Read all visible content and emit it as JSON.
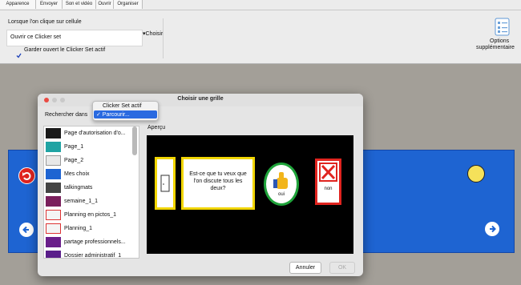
{
  "tabs": [
    "Apparence",
    "Envoyer",
    "Son et vidéo",
    "Ouvrir",
    "Organiser"
  ],
  "settings": {
    "heading": "Lorsque l'on clique sur cellule",
    "field_value": "Ouvrir ce Clicker set",
    "choose_label": "▾Choisir",
    "keep_open_label": "Garder ouvert le Clicker Set actif",
    "keep_open_checked": true,
    "options_label_1": "Options",
    "options_label_2": "supplémentaire"
  },
  "dialog": {
    "title": "Choisir une grille",
    "search_label": "Rechercher dans",
    "preview_label": "Aperçu",
    "cancel": "Annuler",
    "ok": "OK",
    "menu": {
      "item1": "Clicker Set actif",
      "item2": "✓ Parcourir..."
    },
    "grids": [
      "Page d'autorisation d'o...",
      "Page_1",
      "Page_2",
      "Mes choix",
      "talkingmats",
      "semaine_1_1",
      "Planning en pictos_1",
      "Planning_1",
      "partage professionnels...",
      "Dossier administratif_1"
    ],
    "preview": {
      "question": "Est-ce que tu veux que l'on discute tous les deux?",
      "yes": "oui",
      "no": "non"
    }
  },
  "colors": {
    "stage_blue": "#1e64d2",
    "yellow_border": "#f1d500",
    "yes_green": "#1fa33a",
    "no_red": "#e0241f",
    "menu_highlight": "#2a6ae0"
  }
}
